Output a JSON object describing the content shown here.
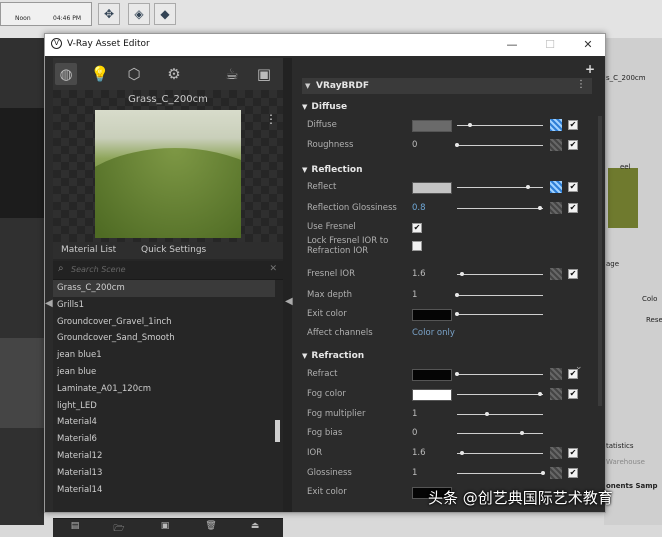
{
  "host": {
    "ruler_left": "Noon",
    "ruler_right": "04:46 PM",
    "right_top_name": "s_C_200cm",
    "right_labels": [
      "eel",
      "age",
      "Colo",
      "Rese",
      "tatistics",
      "Warehouse",
      "onents Samp"
    ]
  },
  "window": {
    "title": "V-Ray Asset Editor",
    "minimize": "—",
    "maximize": "☐",
    "close": "✕"
  },
  "toolbar": {
    "icons": [
      "materials-sphere-icon",
      "lights-bulb-icon",
      "geometry-cube-icon",
      "textures-gear-icon",
      "render-elements-teapot-icon",
      "render-output-icon"
    ]
  },
  "preview": {
    "name": "Grass_C_200cm",
    "menu": "⋮"
  },
  "tabs": {
    "material_list": "Material List",
    "quick_settings": "Quick Settings"
  },
  "search": {
    "placeholder": "Search Scene",
    "clear": "✕"
  },
  "materials": [
    "Grass_C_200cm",
    "Grills1",
    "Groundcover_Gravel_1inch",
    "Groundcover_Sand_Smooth",
    "jean blue1",
    "jean blue",
    "Laminate_A01_120cm",
    "light_LED",
    "Material4",
    "Material6",
    "Material12",
    "Material13",
    "Material14"
  ],
  "selected_material_index": 0,
  "bottom_buttons": [
    "save-all-icon",
    "open-folder-icon",
    "save-icon",
    "delete-icon",
    "import-icon"
  ],
  "brdf": {
    "name": "VRayBRDF",
    "add": "+",
    "menu": "⋮"
  },
  "sections": {
    "diffuse": "Diffuse",
    "reflection": "Reflection",
    "refraction": "Refraction"
  },
  "params": {
    "diffuse": {
      "label": "Diffuse",
      "color": "#6a6a6a",
      "slider": 0.15
    },
    "roughness": {
      "label": "Roughness",
      "value": "0",
      "slider": 0.0
    },
    "reflect": {
      "label": "Reflect",
      "color": "#c4c4c4",
      "slider": 0.82
    },
    "reflection_glossiness": {
      "label": "Reflection Glossiness",
      "value": "0.8",
      "slider": 0.96
    },
    "use_fresnel": {
      "label": "Use Fresnel",
      "checked": "✔"
    },
    "lock_fresnel": {
      "label": "Lock Fresnel IOR to Refraction IOR"
    },
    "fresnel_ior": {
      "label": "Fresnel IOR",
      "value": "1.6",
      "slider": 0.06
    },
    "max_depth": {
      "label": "Max depth",
      "value": "1",
      "slider": 0.0
    },
    "exit_color": {
      "label": "Exit color",
      "color": "#050505",
      "slider": 0.0
    },
    "affect_channels": {
      "label": "Affect channels",
      "value": "Color only"
    },
    "refract": {
      "label": "Refract",
      "color": "#050505",
      "slider": 0.0
    },
    "fog_color": {
      "label": "Fog color",
      "color": "#ffffff",
      "slider": 0.96
    },
    "fog_multiplier": {
      "label": "Fog multiplier",
      "value": "1",
      "slider": 0.35
    },
    "fog_bias": {
      "label": "Fog bias",
      "value": "0",
      "slider": 0.75
    },
    "ior": {
      "label": "IOR",
      "value": "1.6",
      "slider": 0.06
    },
    "glossiness": {
      "label": "Glossiness",
      "value": "1",
      "slider": 1.0
    },
    "exit_color2": {
      "label": "Exit color",
      "color": "#050505"
    }
  },
  "checkmark": "✔",
  "watermark": "头条 @创艺典国际艺术教育"
}
